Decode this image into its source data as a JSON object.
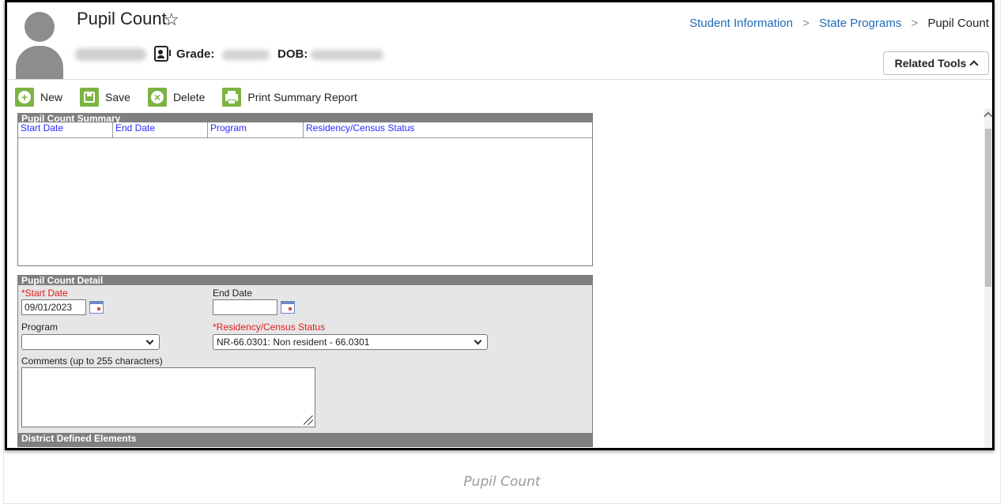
{
  "header": {
    "title": "Pupil Count",
    "grade_label": "Grade:",
    "dob_label": "DOB:"
  },
  "breadcrumb": {
    "items": [
      "Student Information",
      "State Programs",
      "Pupil Count"
    ],
    "separator": ">"
  },
  "related_tools": {
    "label": "Related Tools"
  },
  "toolbar": {
    "new_label": "New",
    "save_label": "Save",
    "delete_label": "Delete",
    "print_label": "Print Summary Report"
  },
  "summary": {
    "title": "Pupil Count Summary",
    "columns": [
      "Start Date",
      "End Date",
      "Program",
      "Residency/Census Status"
    ],
    "rows": []
  },
  "detail": {
    "title": "Pupil Count Detail",
    "start_date_label": "*Start Date",
    "start_date_value": "09/01/2023",
    "end_date_label": "End Date",
    "end_date_value": "",
    "program_label": "Program",
    "program_value": "",
    "residency_label": "*Residency/Census Status",
    "residency_value": "NR-66.0301: Non resident - 66.0301",
    "comments_label": "Comments (up to 255 characters)",
    "comments_value": "",
    "district_defined_label": "District Defined Elements"
  },
  "caption": "Pupil Count",
  "colors": {
    "accent_green": "#7cb342",
    "link_blue": "#1f6bb5",
    "required_red": "#e31b1b",
    "panel_gray": "#7f7f7f"
  }
}
